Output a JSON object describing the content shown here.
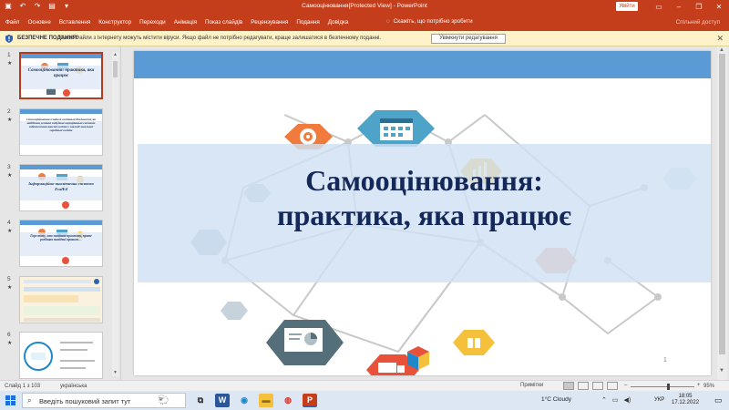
{
  "window": {
    "title": "Самооцінювання[Protected View]  -  PowerPoint",
    "signin_label": "Увійти",
    "quick_access": [
      "save-icon",
      "undo-icon",
      "redo-icon",
      "start-from-beginning-icon"
    ],
    "controls": [
      "ribbon-display-icon",
      "minimize-icon",
      "maximize-icon",
      "close-icon"
    ]
  },
  "ribbon": {
    "tabs": [
      "Файл",
      "Основне",
      "Вставлення",
      "Конструктор",
      "Переходи",
      "Анімація",
      "Показ слайдів",
      "Рецензування",
      "Подання",
      "Довідка"
    ],
    "tell_me": "Скажіть, що потрібно зробити",
    "share": "Спільний доступ"
  },
  "protected_view": {
    "label": "БЕЗПЕЧНЕ ПОДАННЯ",
    "message": "Увага! Файли з Інтернету можуть містити віруси. Якщо файл не потрібно редагувати, краще залишатися в безпечному поданні.",
    "enable_button": "Увімкнути редагування"
  },
  "thumbnails": [
    {
      "num": "1",
      "text": "Самооцінювання: практика, яка працює",
      "selected": true
    },
    {
      "num": "2",
      "text": "Самооцінювання вчителі освітньої діяльності, як найбільш успішні побудови внутрішньої системи забезпечення якості освіти у закладі загальної середньої освіти",
      "selected": false
    },
    {
      "num": "3",
      "text": "Інформаційно-аналітична система EvalEd",
      "selected": false
    },
    {
      "num": "4",
      "text": "Горе тому, хто знайшов простоту, проте розбивав знайдені правила…",
      "selected": false
    },
    {
      "num": "5",
      "text": "",
      "selected": false
    },
    {
      "num": "6",
      "text": "",
      "selected": false
    }
  ],
  "slide": {
    "title_line1": "Самооцінювання:",
    "title_line2": "практика, яка працює",
    "page_number": "1"
  },
  "status": {
    "slide_info": "Слайд 1 з 103",
    "language": "українська",
    "notes": "Примітки",
    "zoom": "95%"
  },
  "taskbar": {
    "search_placeholder": "Введіть пошуковий запит тут",
    "weather": "1°C  Cloudy",
    "keyboard": "УКР",
    "time": "18:05",
    "date": "17.12.2022"
  },
  "colors": {
    "accent": "#c43e1c",
    "slide_band": "#5b9bd5",
    "title_color": "#14285a"
  }
}
